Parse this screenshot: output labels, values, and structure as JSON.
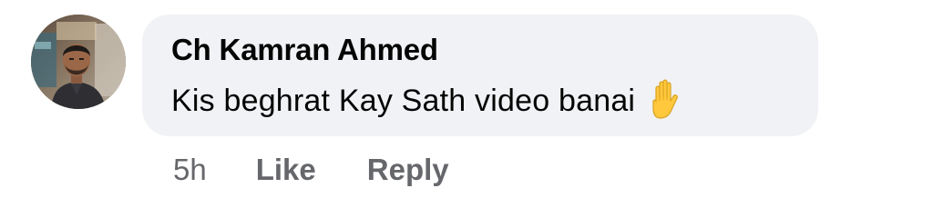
{
  "comment": {
    "author": "Ch Kamran Ahmed",
    "text": "Kis beghrat Kay Sath video banai",
    "emoji_icon": "raised-hand-icon"
  },
  "actions": {
    "timestamp": "5h",
    "like_label": "Like",
    "reply_label": "Reply"
  },
  "colors": {
    "bubble_bg": "#f0f2f5",
    "text_primary": "#050505",
    "text_secondary": "#65676b"
  }
}
